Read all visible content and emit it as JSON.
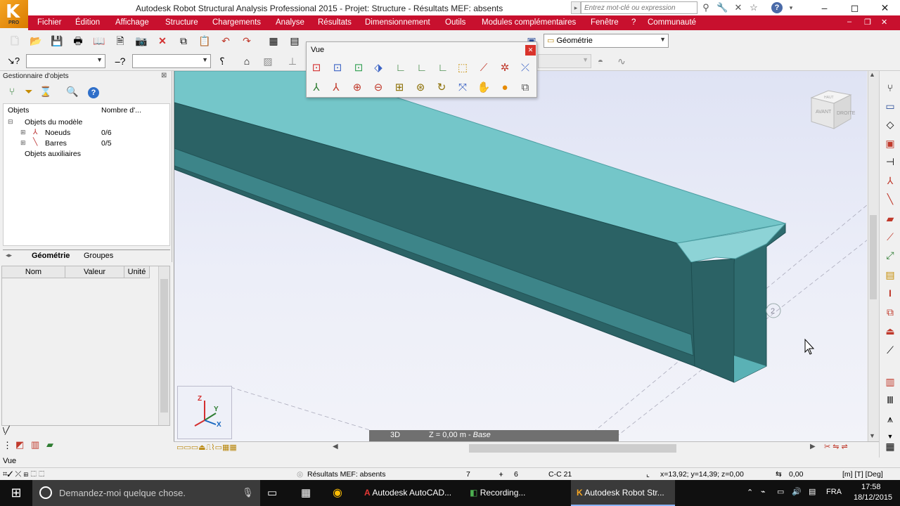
{
  "window": {
    "title": "Autodesk Robot Structural Analysis Professional 2015 - Projet: Structure - Résultats MEF: absents",
    "logo_label": "PRO",
    "controls": [
      "–",
      "◻",
      "✕"
    ]
  },
  "search": {
    "placeholder": "Entrez mot-clé ou expression"
  },
  "menu": {
    "items": [
      "Fichier",
      "Édition",
      "Affichage",
      "Structure",
      "Chargements",
      "Analyse",
      "Résultats",
      "Dimensionnement",
      "Outils",
      "Modules complémentaires",
      "Fenêtre",
      "?",
      "Communauté"
    ]
  },
  "toolbar": {
    "geometry_combo": "Géométrie",
    "combo1_value": "",
    "combo2_value": ""
  },
  "object_manager": {
    "title": "Gestionnaire d'objets",
    "columns": [
      "Objets",
      "Nombre d'..."
    ],
    "tree": [
      {
        "label": "Objets du modèle",
        "count": ""
      },
      {
        "label": "Noeuds",
        "count": "0/6"
      },
      {
        "label": "Barres",
        "count": "0/5"
      },
      {
        "label": "Objets auxiliaires",
        "count": ""
      }
    ],
    "tabs": [
      "Géométrie",
      "Groupes"
    ]
  },
  "properties": {
    "columns": [
      "Nom",
      "Valeur",
      "Unité"
    ]
  },
  "vue_panel": {
    "title": "Vue"
  },
  "viewport": {
    "view_cube": {
      "front": "AVANT",
      "right": "DROITE",
      "top": "HAUT"
    },
    "mode": "3D",
    "level": "Z = 0,00 m - ",
    "level_name": "Base",
    "node_label": "2",
    "axes": {
      "x": "X",
      "y": "Y",
      "z": "Z"
    }
  },
  "bottom": {
    "view_label": "Vue"
  },
  "status": {
    "fem_results": "Résultats MEF: absents",
    "count1": "7",
    "count2": "6",
    "section": "C-C 21",
    "coords": "x=13,92; y=14,39; z=0,00",
    "value": "0,00",
    "units": "[m] [T] [Deg]"
  },
  "taskbar": {
    "cortana": "Demandez-moi quelque chose.",
    "apps": [
      "Autodesk AutoCAD...",
      "Recording...",
      "Autodesk Robot Str..."
    ],
    "lang": "FRA",
    "time": "17:58",
    "date": "18/12/2015"
  },
  "colors": {
    "menu_bar": "#c8102e",
    "beam_top": "#74c6c9",
    "beam_side": "#2b6265",
    "taskbar": "#101010"
  }
}
